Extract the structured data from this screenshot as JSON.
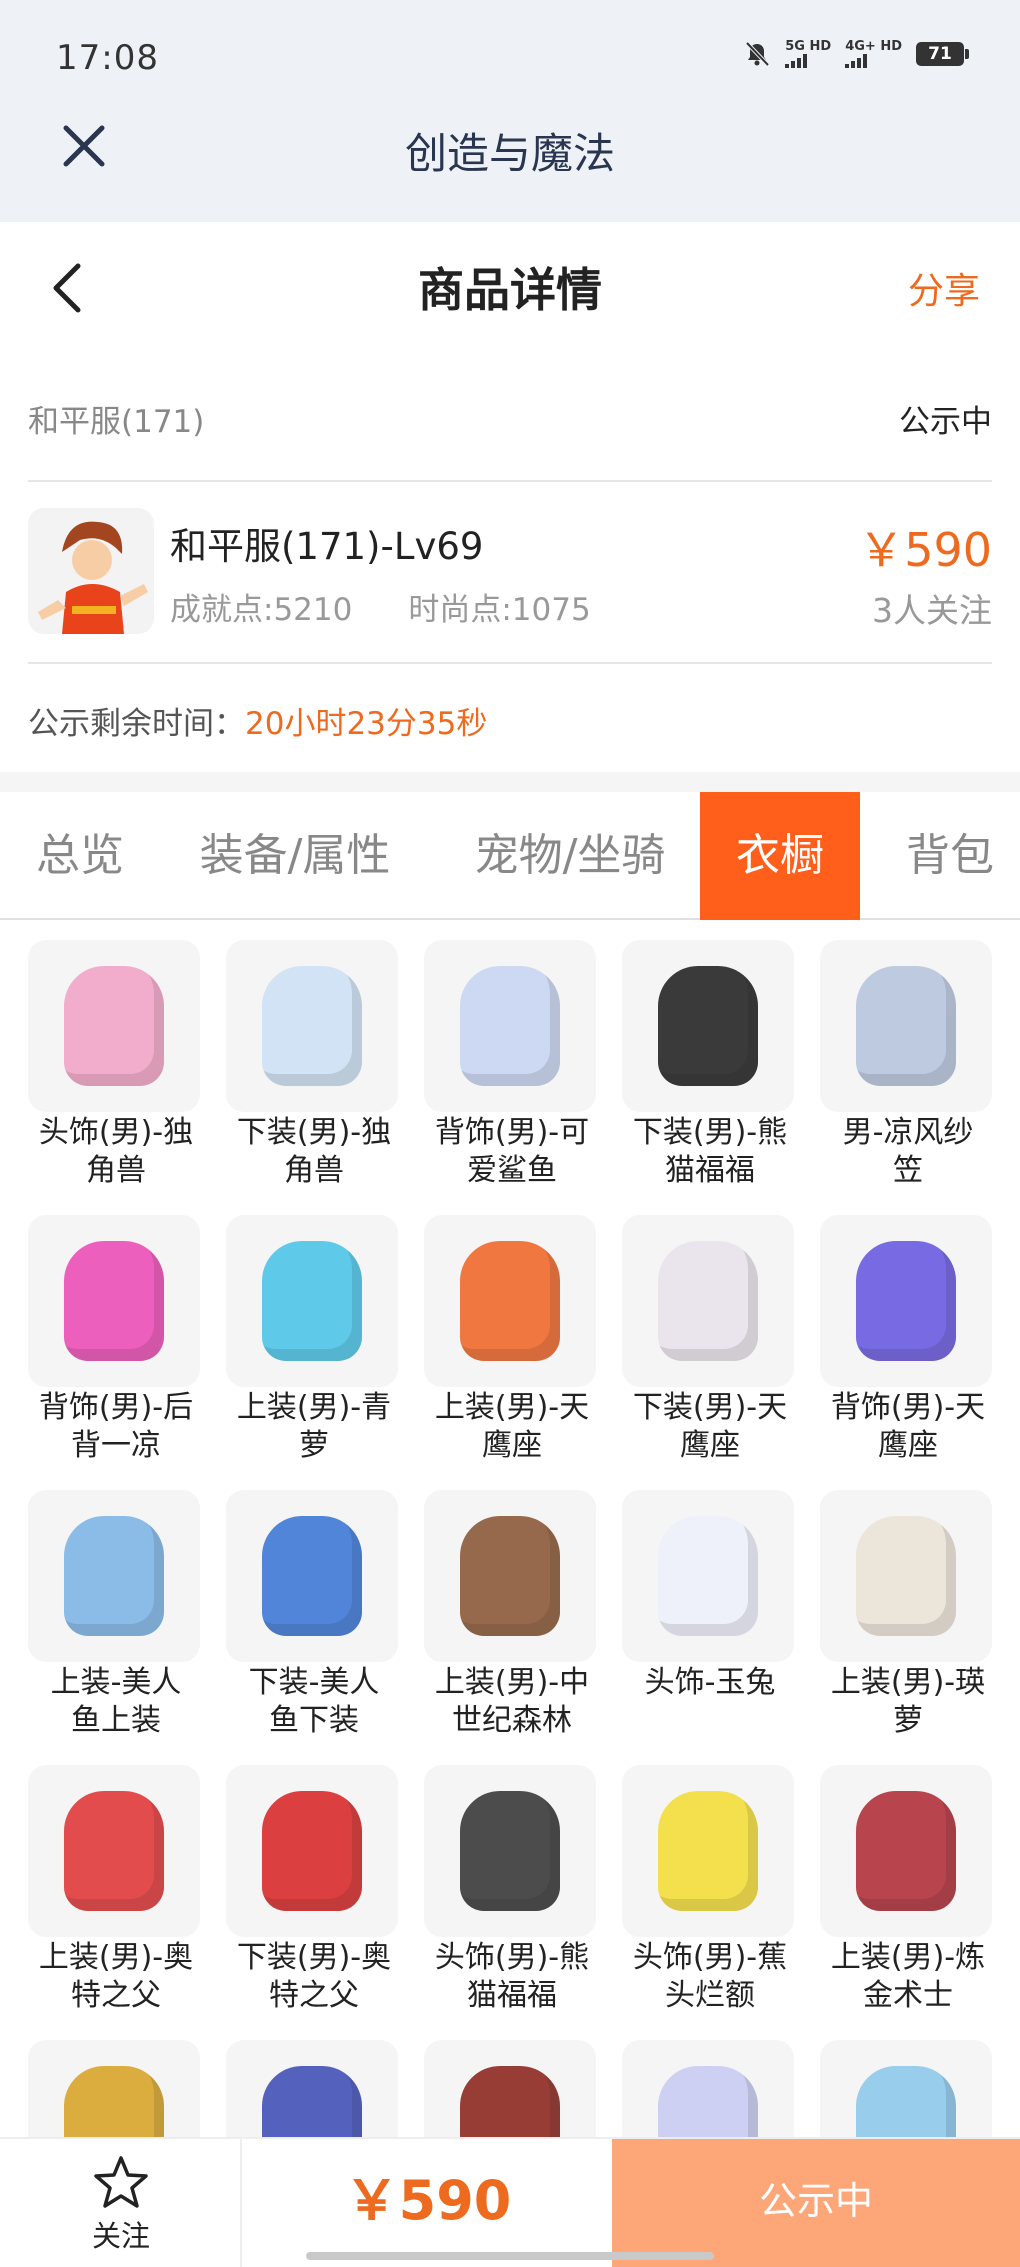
{
  "status_bar": {
    "time": "17:08",
    "sim1": "5G HD",
    "sim2": "4G+ HD",
    "battery": "71"
  },
  "app_bar": {
    "title": "创造与魔法"
  },
  "header": {
    "title": "商品详情",
    "share_label": "分享"
  },
  "listing": {
    "server": "和平服(171)",
    "status": "公示中",
    "name": "和平服(171)-Lv69",
    "achievement": "成就点:5210",
    "fashion": "时尚点:1075",
    "price": "￥590",
    "followers": "3人关注",
    "remain_label": "公示剩余时间：",
    "remain_value": "20小时23分35秒"
  },
  "tabs": [
    {
      "label": "总览",
      "active": false
    },
    {
      "label": "装备/属性",
      "active": false
    },
    {
      "label": "宠物/坐骑",
      "active": false
    },
    {
      "label": "衣橱",
      "active": true
    },
    {
      "label": "背包",
      "active": false
    }
  ],
  "wardrobe": [
    {
      "l1": "头饰(男)-独",
      "l2": "角兽",
      "icon": "unicorn-hood-icon",
      "color": "#f3a6c8"
    },
    {
      "l1": "下装(男)-独",
      "l2": "角兽",
      "icon": "unicorn-boots-icon",
      "color": "#cfe2f5"
    },
    {
      "l1": "背饰(男)-可",
      "l2": "爱鲨鱼",
      "icon": "shark-backpack-icon",
      "color": "#c9d6f2"
    },
    {
      "l1": "下装(男)-熊",
      "l2": "猫福福",
      "icon": "panda-pants-icon",
      "color": "#262626"
    },
    {
      "l1": "男-凉风纱",
      "l2": "笠",
      "icon": "veil-hat-icon",
      "color": "#b9c6de"
    },
    {
      "l1": "背饰(男)-后",
      "l2": "背一凉",
      "icon": "ice-cream-icon",
      "color": "#ec4fb6"
    },
    {
      "l1": "上装(男)-青",
      "l2": "萝",
      "icon": "blue-robe-icon",
      "color": "#4ec5e8"
    },
    {
      "l1": "上装(男)-天",
      "l2": "鹰座",
      "icon": "orange-jacket-icon",
      "color": "#f06a2c"
    },
    {
      "l1": "下装(男)-天",
      "l2": "鹰座",
      "icon": "white-pants-icon",
      "color": "#e9e4ec"
    },
    {
      "l1": "背饰(男)-天",
      "l2": "鹰座",
      "icon": "tech-pack-icon",
      "color": "#6b5be0"
    },
    {
      "l1": "上装-美人",
      "l2": "鱼上装",
      "icon": "mermaid-top-icon",
      "color": "#7fb6e6"
    },
    {
      "l1": "下装-美人",
      "l2": "鱼下装",
      "icon": "mermaid-tail-icon",
      "color": "#3f79d6"
    },
    {
      "l1": "上装(男)-中",
      "l2": "世纪森林",
      "icon": "medieval-vest-icon",
      "color": "#8c5a3a"
    },
    {
      "l1": "头饰-玉兔",
      "l2": "",
      "icon": "jade-rabbit-icon",
      "color": "#eef0fb"
    },
    {
      "l1": "上装(男)-瑛",
      "l2": "萝",
      "icon": "scarf-coat-icon",
      "color": "#ece4d8"
    },
    {
      "l1": "上装(男)-奥",
      "l2": "特之父",
      "icon": "hero-suit-icon",
      "color": "#e23a3a"
    },
    {
      "l1": "下装(男)-奥",
      "l2": "特之父",
      "icon": "hero-boots-icon",
      "color": "#d92c2c"
    },
    {
      "l1": "头饰(男)-熊",
      "l2": "猫福福",
      "icon": "panda-hood-icon",
      "color": "#3a3a3a"
    },
    {
      "l1": "头饰(男)-蕉",
      "l2": "头烂额",
      "icon": "banana-hat-icon",
      "color": "#f4de3b"
    },
    {
      "l1": "上装(男)-炼",
      "l2": "金术士",
      "icon": "alchemist-coat-icon",
      "color": "#b2323c"
    },
    {
      "l1": "",
      "l2": "",
      "icon": "gold-crown-icon",
      "color": "#d9a52b"
    },
    {
      "l1": "",
      "l2": "",
      "icon": "star-robe-icon",
      "color": "#4353b8"
    },
    {
      "l1": "",
      "l2": "",
      "icon": "red-pants-icon",
      "color": "#8e2a22"
    },
    {
      "l1": "",
      "l2": "",
      "icon": "moon-horns-icon",
      "color": "#c9cdf2"
    },
    {
      "l1": "",
      "l2": "",
      "icon": "ice-crown-icon",
      "color": "#8ec9ec"
    }
  ],
  "bottom_bar": {
    "follow_label": "关注",
    "price": "￥590",
    "status": "公示中"
  }
}
